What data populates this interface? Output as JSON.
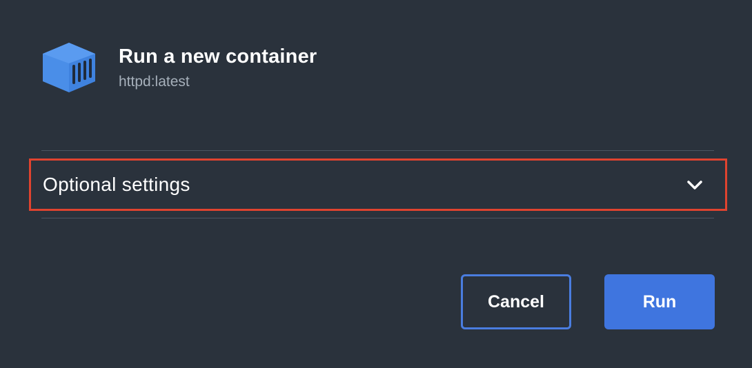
{
  "dialog": {
    "title": "Run a new container",
    "image_name": "httpd:latest",
    "icon": "container-icon"
  },
  "optional_settings": {
    "label": "Optional settings",
    "icon": "chevron-down-icon",
    "highlight_color": "#e0432f"
  },
  "actions": {
    "cancel_label": "Cancel",
    "run_label": "Run"
  },
  "colors": {
    "background": "#2a323c",
    "accent": "#3f75df",
    "icon_blue": "#4a8ee8"
  }
}
